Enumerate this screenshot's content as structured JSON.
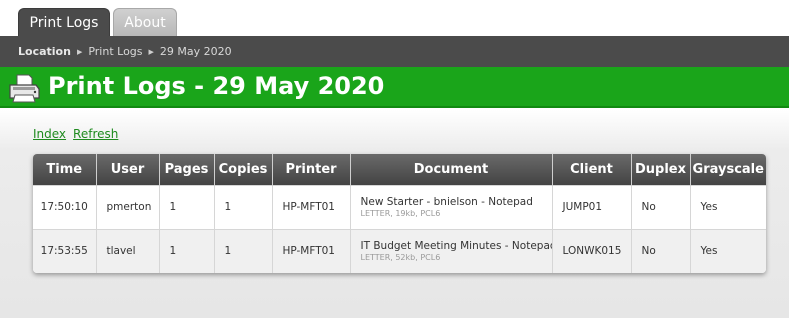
{
  "tabs": [
    {
      "label": "Print Logs",
      "active": true
    },
    {
      "label": "About",
      "active": false
    }
  ],
  "breadcrumb": {
    "location_label": "Location",
    "items": [
      "Print Logs",
      "29 May 2020"
    ]
  },
  "page": {
    "title": "Print Logs - 29 May 2020",
    "icon": "printer-icon"
  },
  "links": {
    "index": "Index",
    "refresh": "Refresh"
  },
  "table": {
    "columns": [
      "Time",
      "User",
      "Pages",
      "Copies",
      "Printer",
      "Document",
      "Client",
      "Duplex",
      "Grayscale"
    ],
    "rows": [
      {
        "time": "17:50:10",
        "user": "pmerton",
        "pages": "1",
        "copies": "1",
        "printer": "HP-MFT01",
        "document": "New Starter - bnielson - Notepad",
        "document_meta": "LETTER, 19kb, PCL6",
        "client": "JUMP01",
        "duplex": "No",
        "grayscale": "Yes"
      },
      {
        "time": "17:53:55",
        "user": "tlavel",
        "pages": "1",
        "copies": "1",
        "printer": "HP-MFT01",
        "document": "IT Budget Meeting Minutes - Notepad",
        "document_meta": "LETTER, 52kb, PCL6",
        "client": "LONWK015",
        "duplex": "No",
        "grayscale": "Yes"
      }
    ]
  },
  "colors": {
    "title_bar": "#1aa51a",
    "nav_bar": "#4b4b4b",
    "link": "#1e8a1e"
  }
}
